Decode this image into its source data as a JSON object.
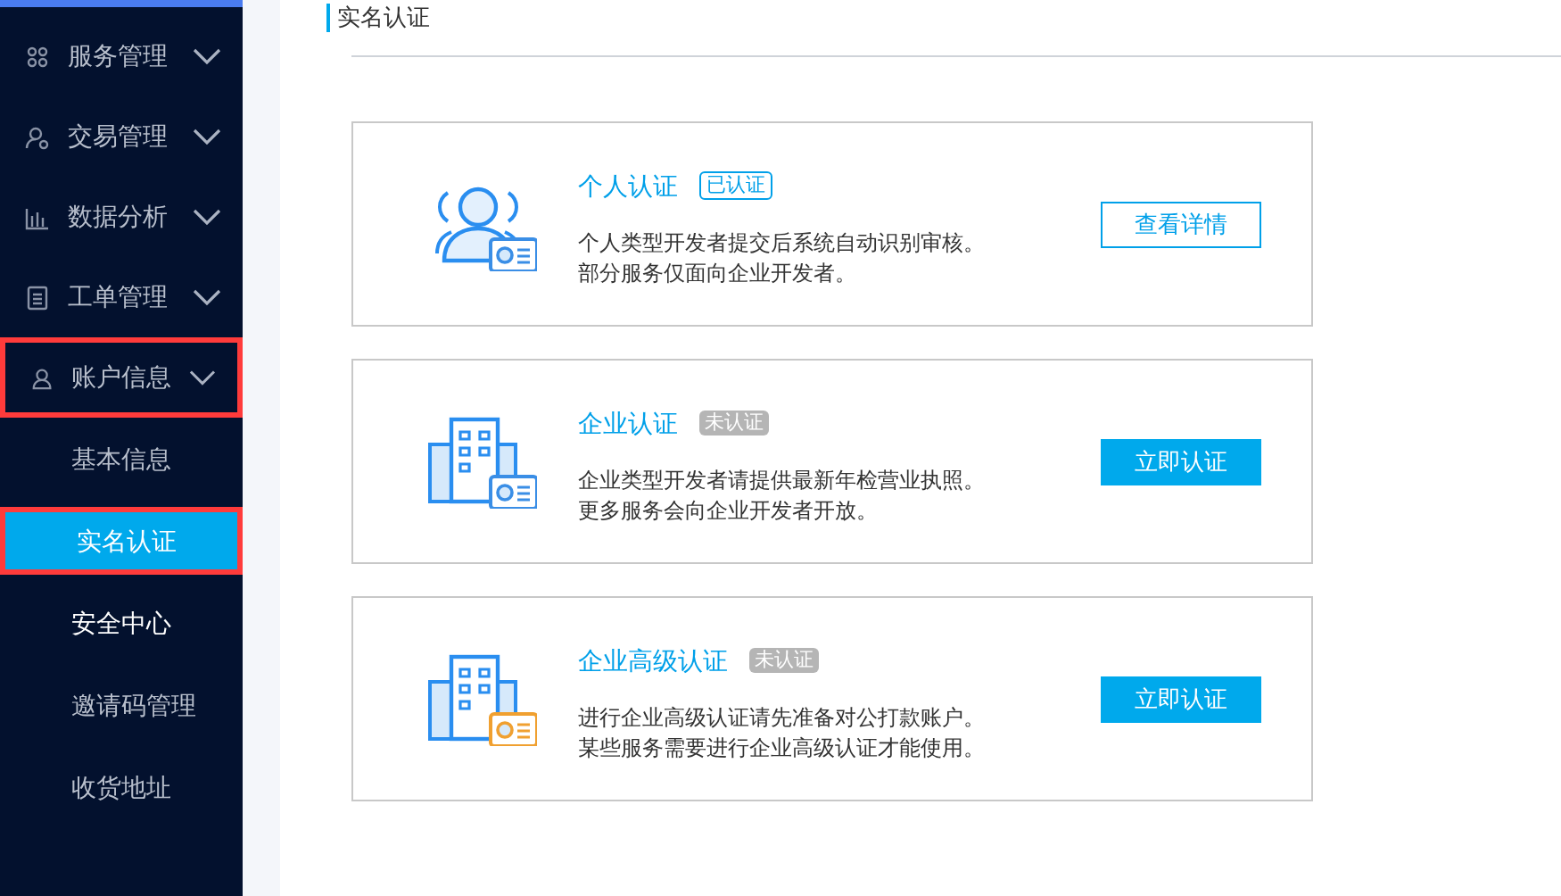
{
  "sidebar": {
    "items": [
      {
        "label": "服务管理",
        "kind": "grid",
        "annotated": false
      },
      {
        "label": "交易管理",
        "kind": "user-coin",
        "annotated": false
      },
      {
        "label": "数据分析",
        "kind": "chart",
        "annotated": false
      },
      {
        "label": "工单管理",
        "kind": "document",
        "annotated": false
      },
      {
        "label": "账户信息",
        "kind": "user",
        "annotated": true,
        "children": [
          {
            "label": "基本信息",
            "selected": false,
            "hovered": false,
            "annotated": false
          },
          {
            "label": "实名认证",
            "selected": true,
            "hovered": false,
            "annotated": true
          },
          {
            "label": "安全中心",
            "selected": false,
            "hovered": true,
            "annotated": false
          },
          {
            "label": "邀请码管理",
            "selected": false,
            "hovered": false,
            "annotated": false
          },
          {
            "label": "收货地址",
            "selected": false,
            "hovered": false,
            "annotated": false
          }
        ]
      }
    ]
  },
  "page": {
    "title": "实名认证"
  },
  "cards": [
    {
      "title": "个人认证",
      "kind": "person",
      "badge": "已认证",
      "verified": true,
      "lines": [
        "个人类型开发者提交后系统自动识别审核。",
        "部分服务仅面向企业开发者。"
      ],
      "button": "查看详情"
    },
    {
      "title": "企业认证",
      "kind": "building",
      "badge": "未认证",
      "verified": false,
      "lines": [
        "企业类型开发者请提供最新年检营业执照。",
        "更多服务会向企业开发者开放。"
      ],
      "button": "立即认证"
    },
    {
      "title": "企业高级认证",
      "kind": "building-premium",
      "badge": "未认证",
      "verified": false,
      "lines": [
        "进行企业高级认证请先准备对公打款账户。",
        "某些服务需要进行企业高级认证才能使用。"
      ],
      "button": "立即认证"
    }
  ]
}
